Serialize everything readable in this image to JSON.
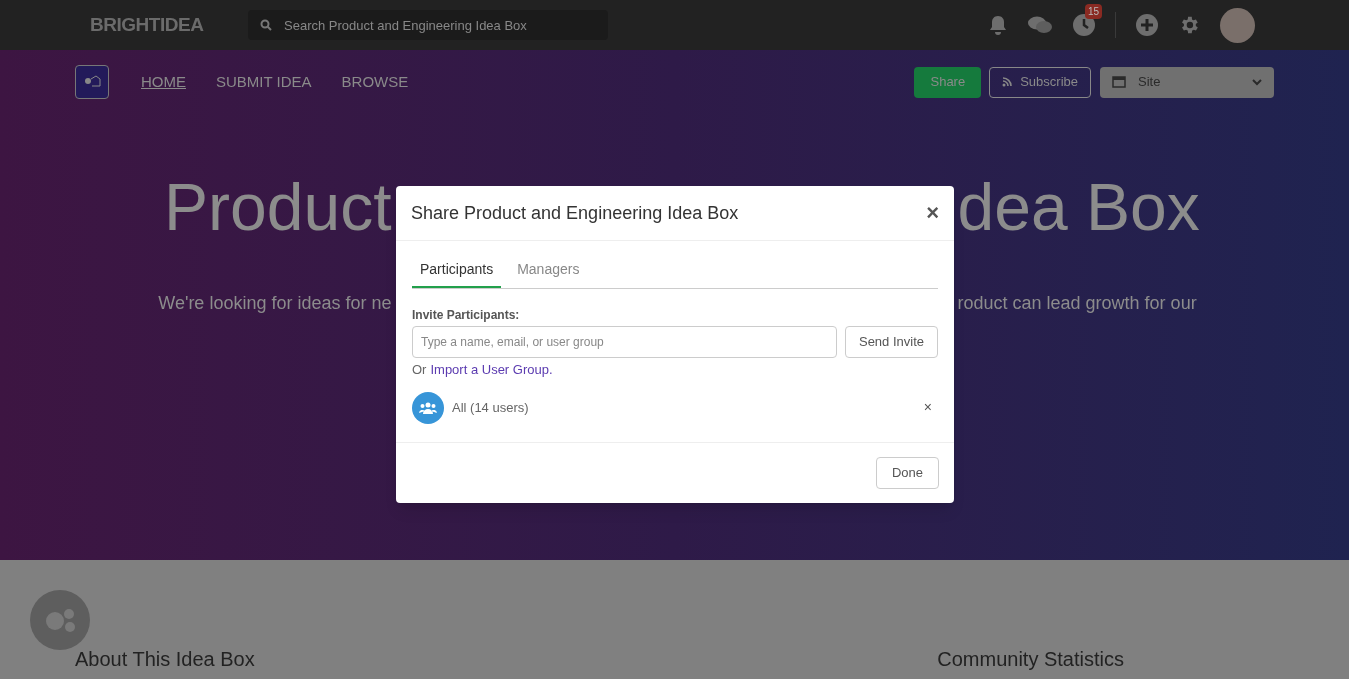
{
  "topbar": {
    "logo": "BRIGHTIDEA",
    "search": {
      "placeholder": "Search Product and Engineering Idea Box"
    },
    "badge": "15"
  },
  "nav": {
    "items": [
      {
        "label": "HOME",
        "selected": true
      },
      {
        "label": "SUBMIT IDEA",
        "selected": false
      },
      {
        "label": "BROWSE",
        "selected": false
      }
    ],
    "share": "Share",
    "subscribe": "Subscribe",
    "site_select": "Site"
  },
  "hero": {
    "title_left": "Product",
    "title_right": "dea Box",
    "text_left": "We're looking for ideas for ne",
    "text_right": "roduct can lead growth for our"
  },
  "sections": [
    "About This Idea Box",
    "Community Statistics"
  ],
  "dialog": {
    "title": "Share Product and Engineering Idea Box",
    "close": "×",
    "tabs": [
      {
        "label": "Participants",
        "selected": true
      },
      {
        "label": "Managers",
        "selected": false
      }
    ],
    "invite_label": "Invite Participants:",
    "invite": {
      "placeholder": "Type a name, email, or user group"
    },
    "send": "Send Invite",
    "import_prefix": "Or",
    "import_link": "Import a User Group.",
    "participants": [
      {
        "name": "All (14 users)",
        "remove": "×"
      }
    ],
    "done": "Done"
  }
}
